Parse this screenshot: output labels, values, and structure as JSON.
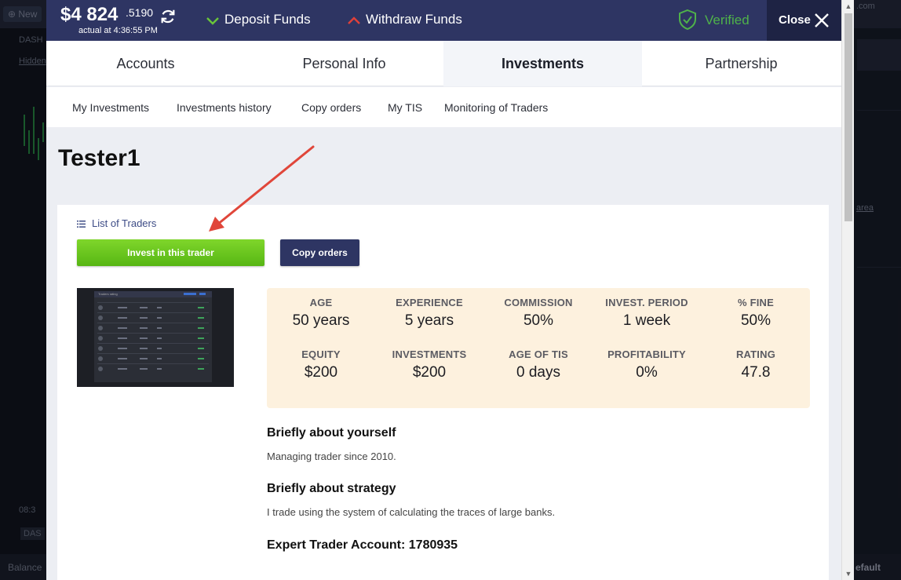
{
  "background": {
    "new_label": "New",
    "left_texts": [
      "DASH",
      "Hidden",
      "08:3",
      "DAS"
    ],
    "right_texts": [
      ".com",
      "area"
    ],
    "bottom_left": "Balance",
    "bottom_right": "efault"
  },
  "header": {
    "balance_main": "$4 824",
    "balance_fraction": ".5190",
    "balance_time": "actual at 4:36:55 PM",
    "deposit_label": "Deposit Funds",
    "withdraw_label": "Withdraw Funds",
    "verified_label": "Verified",
    "close_label": "Close",
    "colors": {
      "header_bg": "#2e3563",
      "verified": "#4fb24a",
      "deposit_chevron": "#6ac53a",
      "withdraw_chevron": "#e0413a"
    }
  },
  "tabs": [
    {
      "label": "Accounts",
      "active": false
    },
    {
      "label": "Personal Info",
      "active": false
    },
    {
      "label": "Investments",
      "active": true
    },
    {
      "label": "Partnership",
      "active": false
    }
  ],
  "subtabs": [
    "My Investments",
    "Investments history",
    "Copy orders",
    "My TIS",
    "Monitoring of Traders"
  ],
  "trader": {
    "name": "Tester1",
    "list_link": "List of Traders",
    "invest_button": "Invest in this trader",
    "copy_button": "Copy orders",
    "thumbnail_title": "Traders rating",
    "stats": [
      {
        "label": "AGE",
        "value": "50 years"
      },
      {
        "label": "EXPERIENCE",
        "value": "5 years"
      },
      {
        "label": "COMMISSION",
        "value": "50%"
      },
      {
        "label": "INVEST. PERIOD",
        "value": "1 week"
      },
      {
        "label": "% FINE",
        "value": "50%"
      },
      {
        "label": "EQUITY",
        "value": "$200"
      },
      {
        "label": "INVESTMENTS",
        "value": "$200"
      },
      {
        "label": "AGE OF TIS",
        "value": "0 days"
      },
      {
        "label": "PROFITABILITY",
        "value": "0%"
      },
      {
        "label": "RATING",
        "value": "47.8"
      }
    ],
    "about_heading": "Briefly about yourself",
    "about_text": "Managing trader since 2010.",
    "strategy_heading": "Briefly about strategy",
    "strategy_text": "I trade using the system of calculating the traces of large banks.",
    "account_label": "Expert Trader Account: 1780935"
  },
  "annotation": {
    "arrow_color": "#e0463a"
  }
}
